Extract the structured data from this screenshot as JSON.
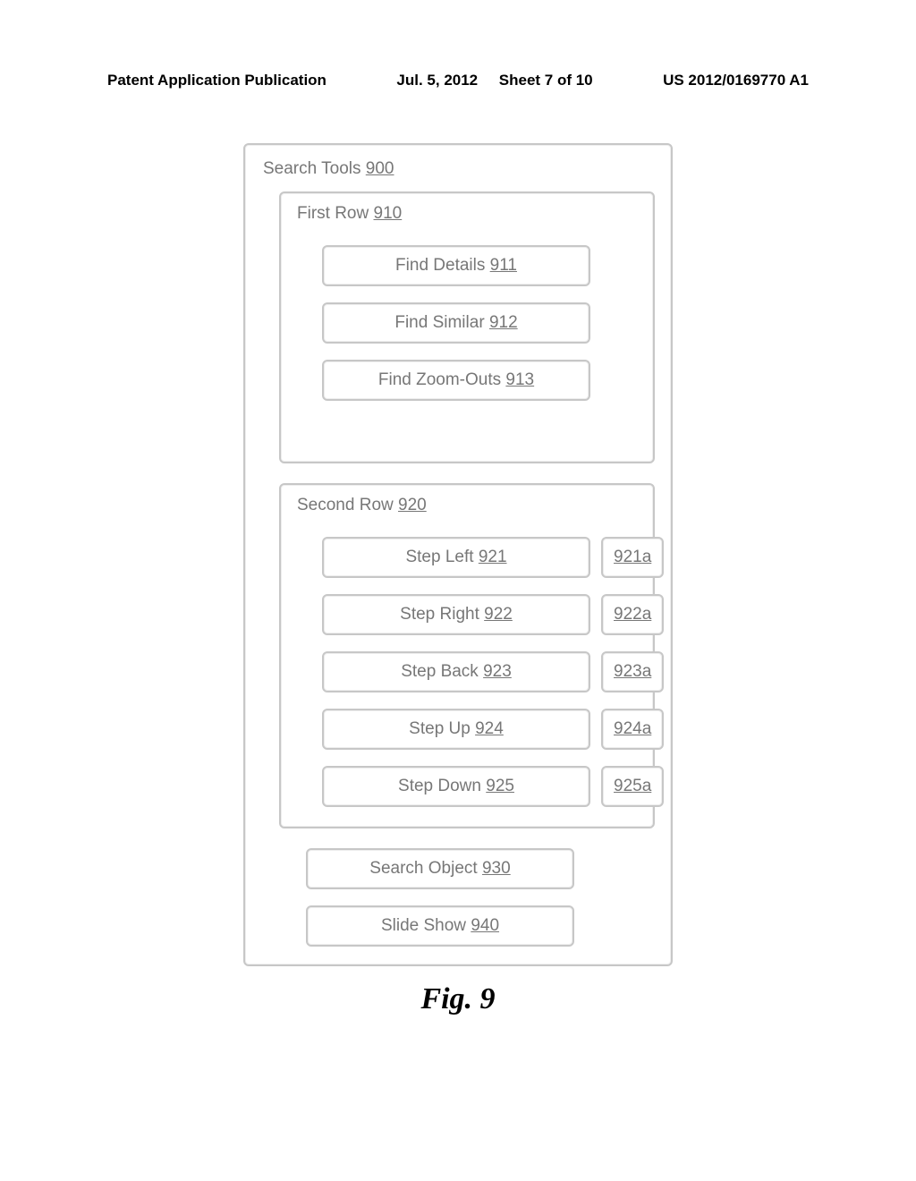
{
  "header": {
    "left": "Patent Application Publication",
    "mid_prefix": "Jul. 5, 2012",
    "mid_sheet": "Sheet 7 of 10",
    "right": "US 2012/0169770 A1"
  },
  "figure_label": "Fig. 9",
  "search_tools": {
    "label": "Search Tools",
    "ref": "900",
    "first_row": {
      "label": "First Row",
      "ref": "910",
      "items": [
        {
          "label": "Find Details",
          "ref": "911"
        },
        {
          "label": "Find Similar",
          "ref": "912"
        },
        {
          "label": "Find Zoom-Outs",
          "ref": "913"
        }
      ]
    },
    "second_row": {
      "label": "Second Row",
      "ref": "920",
      "items": [
        {
          "label": "Step Left",
          "ref": "921",
          "aux": "921a"
        },
        {
          "label": "Step Right",
          "ref": "922",
          "aux": "922a"
        },
        {
          "label": "Step Back",
          "ref": "923",
          "aux": "923a"
        },
        {
          "label": "Step Up",
          "ref": "924",
          "aux": "924a"
        },
        {
          "label": "Step Down",
          "ref": "925",
          "aux": "925a"
        }
      ]
    },
    "bottom": [
      {
        "label": "Search Object",
        "ref": "930"
      },
      {
        "label": "Slide Show",
        "ref": "940"
      }
    ]
  }
}
